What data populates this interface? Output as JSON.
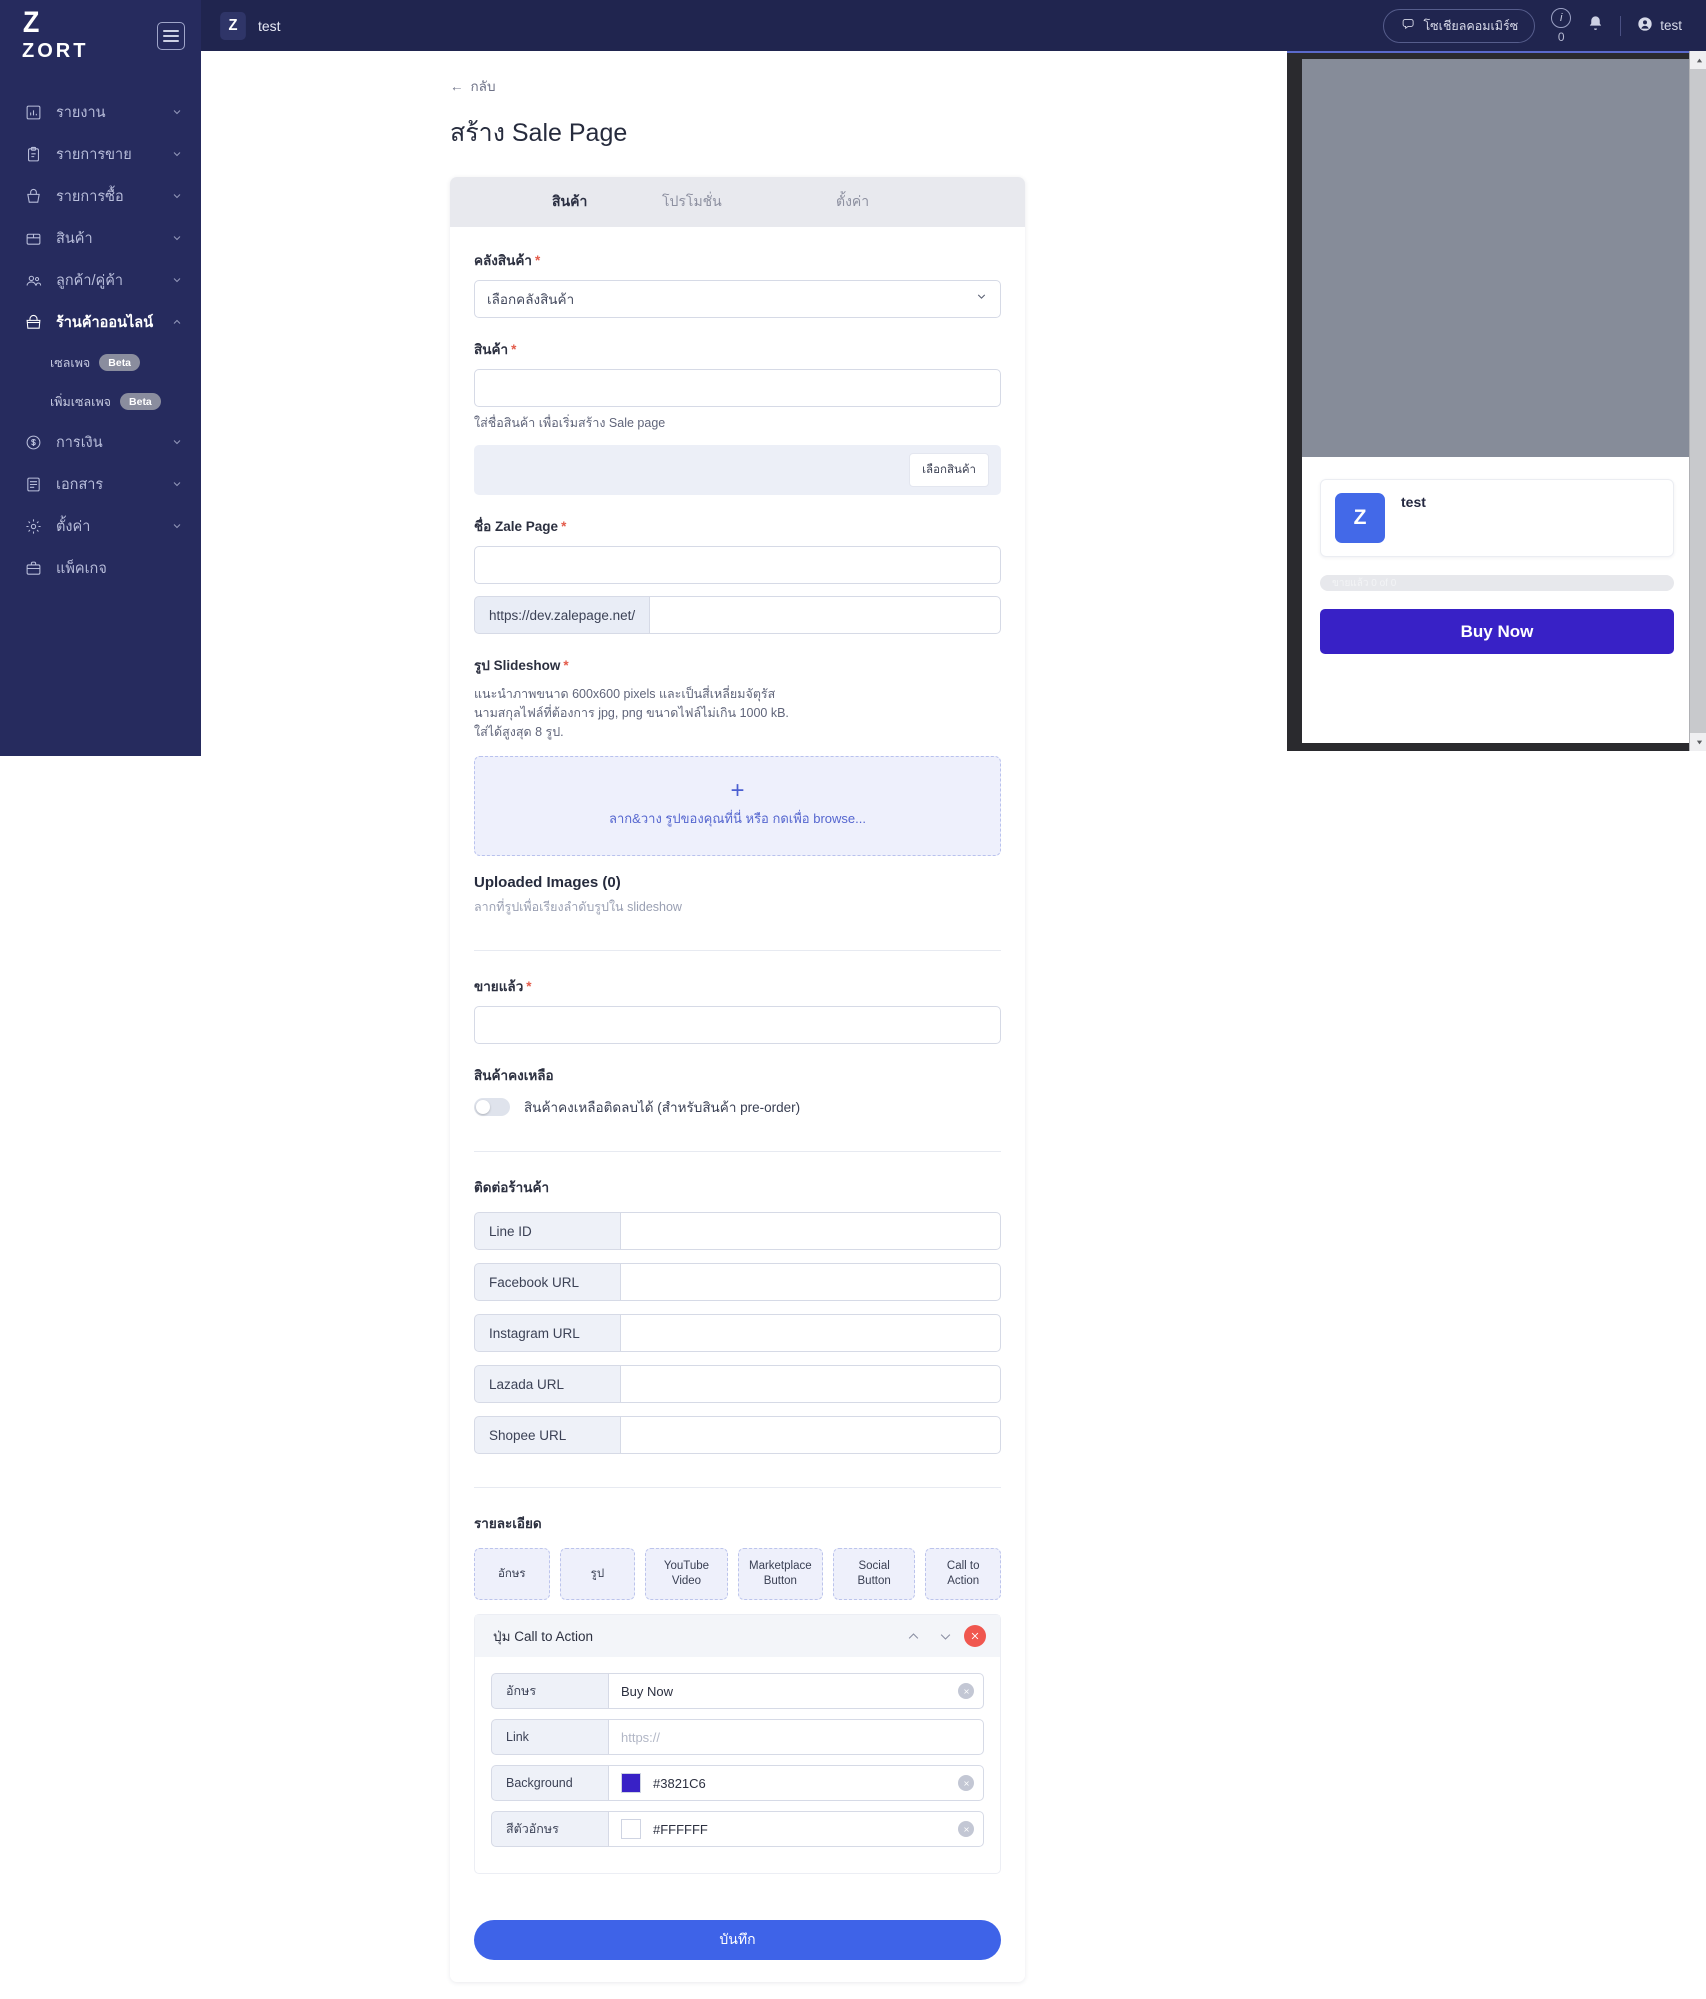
{
  "sidebar": {
    "brand_mark": "Z",
    "brand_word": "ZORT",
    "items": [
      {
        "label": "รายงาน",
        "icon": "chart-icon"
      },
      {
        "label": "รายการขาย",
        "icon": "clipboard-icon"
      },
      {
        "label": "รายการซื้อ",
        "icon": "basket-icon"
      },
      {
        "label": "สินค้า",
        "icon": "box-icon"
      },
      {
        "label": "ลูกค้า/คู่ค้า",
        "icon": "people-icon"
      },
      {
        "label": "ร้านค้าออนไลน์",
        "icon": "store-icon"
      },
      {
        "label": "การเงิน",
        "icon": "dollar-icon"
      },
      {
        "label": "เอกสาร",
        "icon": "document-icon"
      },
      {
        "label": "ตั้งค่า",
        "icon": "gear-icon"
      },
      {
        "label": "แพ็คเกจ",
        "icon": "briefcase-icon"
      }
    ],
    "sub_items": [
      {
        "label": "เซลเพจ",
        "badge": "Beta"
      },
      {
        "label": "เพิ่มเซลเพจ",
        "badge": "Beta"
      }
    ]
  },
  "topbar": {
    "avatar_letter": "Z",
    "shop_name": "test",
    "social_pill": "โซเชียลคอมเมิร์ซ",
    "info_letter": "i",
    "info_count": "0",
    "user_name": "test"
  },
  "page": {
    "back_label": "กลับ",
    "title": "สร้าง Sale Page"
  },
  "tabs": [
    {
      "label": "สินค้า"
    },
    {
      "label": "โปรโมชั่น"
    },
    {
      "label": "ตั้งค่า"
    }
  ],
  "form": {
    "warehouse": {
      "label": "คลังสินค้า",
      "required": "*",
      "selected": "เลือกคลังสินค้า"
    },
    "product": {
      "label": "สินค้า",
      "required": "*",
      "value": "",
      "placeholder": "",
      "hint": "ใส่ชื่อสินค้า เพื่อเริ่มสร้าง Sale page",
      "picker_button": "เลือกสินค้า"
    },
    "zale_page_name": {
      "label": "ชื่อ Zale Page",
      "required": "*",
      "value": "",
      "url_prefix": "https://dev.zalepage.net/",
      "url_value": ""
    },
    "slideshow": {
      "label": "รูป Slideshow",
      "required": "*",
      "hint_line1": "แนะนำภาพขนาด 600x600 pixels และเป็นสี่เหลี่ยมจัตุรัส",
      "hint_line2": "นามสกุลไฟล์ที่ต้องการ jpg, png ขนาดไฟล์ไม่เกิน 1000 kB.",
      "hint_line3": "ใส่ได้สูงสุด 8 รูป.",
      "dropzone_plus": "+",
      "dropzone_text": "ลาก&วาง รูปของคุณที่นี่ หรือ กดเพื่อ browse...",
      "uploaded_title": "Uploaded Images (0)",
      "uploaded_sub": "ลากที่รูปเพื่อเรียงลำดับรูปใน slideshow"
    },
    "sold": {
      "label": "ขายแล้ว",
      "required": "*",
      "value": ""
    },
    "stock": {
      "label": "สินค้าคงเหลือ",
      "toggle_label": "สินค้าคงเหลือติดลบได้ (สำหรับสินค้า pre-order)",
      "toggle_on": false
    },
    "contact": {
      "section_title": "ติดต่อร้านค้า",
      "rows": [
        {
          "label": "Line ID",
          "value": ""
        },
        {
          "label": "Facebook URL",
          "value": ""
        },
        {
          "label": "Instagram URL",
          "value": ""
        },
        {
          "label": "Lazada URL",
          "value": ""
        },
        {
          "label": "Shopee URL",
          "value": ""
        }
      ]
    },
    "details": {
      "section_title": "รายละเอียด",
      "chips": [
        {
          "label": "อักษร"
        },
        {
          "label": "รูป"
        },
        {
          "label": "YouTube Video"
        },
        {
          "label": "Marketplace Button"
        },
        {
          "label": "Social Button"
        },
        {
          "label": "Call to Action"
        }
      ],
      "cta_block": {
        "title": "ปุ่ม Call to Action",
        "rows": [
          {
            "label": "อักษร",
            "value": "Buy Now",
            "placeholder": "",
            "type": "text",
            "clearable": true
          },
          {
            "label": "Link",
            "value": "",
            "placeholder": "https://",
            "type": "text",
            "clearable": false
          },
          {
            "label": "Background",
            "value": "#3821C6",
            "swatch": "#3821C6",
            "type": "color",
            "clearable": true
          },
          {
            "label": "สีตัวอักษร",
            "value": "#FFFFFF",
            "swatch": "#FFFFFF",
            "type": "color",
            "clearable": true
          }
        ]
      }
    },
    "save_label": "บันทึก"
  },
  "preview": {
    "shop_logo_letter": "Z",
    "shop_name": "test",
    "progress_text": "ขายแล้ว 0 of 0",
    "cta_label": "Buy Now",
    "cta_bg": "#3821C6",
    "cta_color": "#FFFFFF"
  }
}
